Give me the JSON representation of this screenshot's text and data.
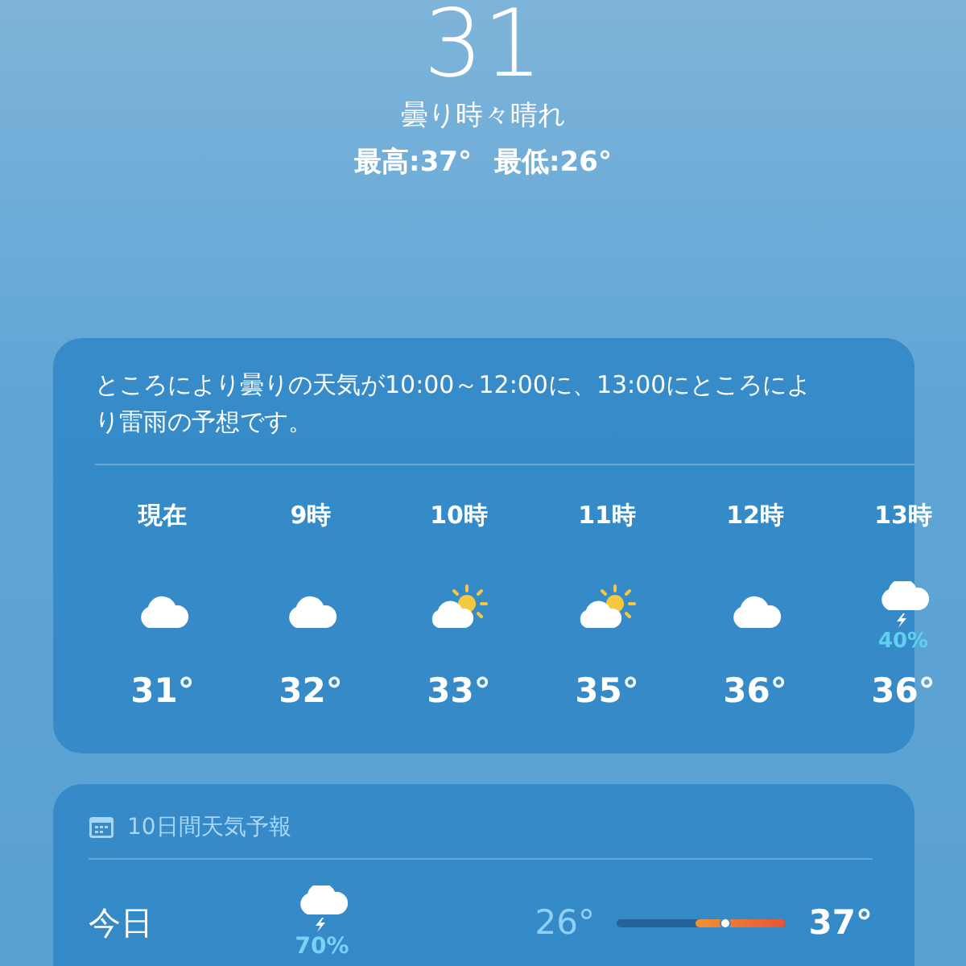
{
  "current": {
    "temperature": "31",
    "condition": "曇り時々晴れ",
    "high": "最高:37°",
    "low": "最低:26°"
  },
  "hourly": {
    "summary": "ところにより曇りの天気が10:00～12:00に、13:00にところにより雷雨の予想です。",
    "hours": [
      {
        "time": "現在",
        "kind": "cloud",
        "temp": "31°"
      },
      {
        "time": "9時",
        "kind": "cloud",
        "temp": "32°"
      },
      {
        "time": "10時",
        "kind": "sun-cloud",
        "temp": "33°"
      },
      {
        "time": "11時",
        "kind": "sun-cloud",
        "temp": "35°"
      },
      {
        "time": "12時",
        "kind": "cloud",
        "temp": "36°"
      },
      {
        "time": "13時",
        "kind": "thunder",
        "precip": "40%",
        "temp": "36°"
      }
    ]
  },
  "daily": {
    "title": "10日間天気予報",
    "days": [
      {
        "day": "今日",
        "kind": "thunder",
        "precip": "70%",
        "low": "26°",
        "high": "37°"
      }
    ]
  }
}
